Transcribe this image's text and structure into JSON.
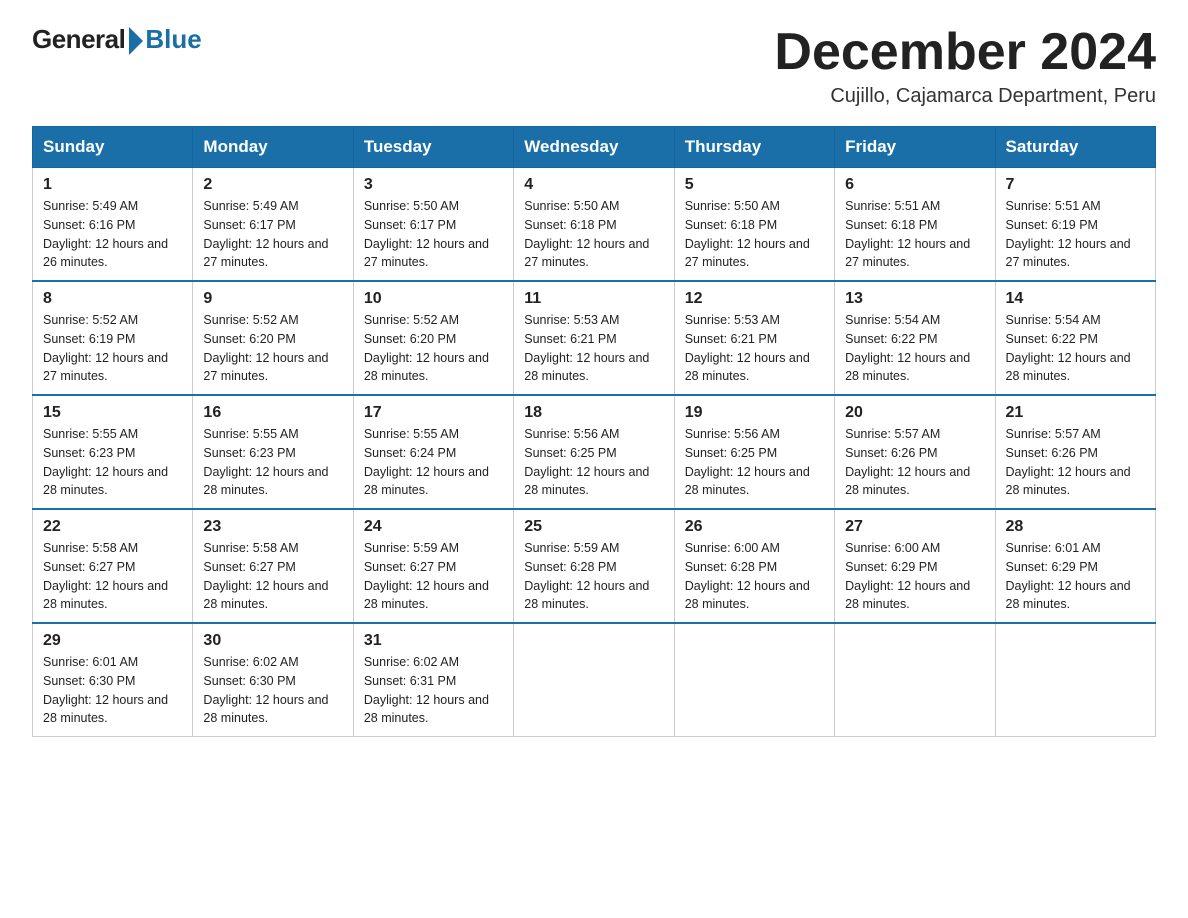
{
  "header": {
    "logo_general": "General",
    "logo_blue": "Blue",
    "month_title": "December 2024",
    "location": "Cujillo, Cajamarca Department, Peru"
  },
  "days_of_week": [
    "Sunday",
    "Monday",
    "Tuesday",
    "Wednesday",
    "Thursday",
    "Friday",
    "Saturday"
  ],
  "weeks": [
    [
      {
        "num": "1",
        "sunrise": "5:49 AM",
        "sunset": "6:16 PM",
        "daylight": "12 hours and 26 minutes."
      },
      {
        "num": "2",
        "sunrise": "5:49 AM",
        "sunset": "6:17 PM",
        "daylight": "12 hours and 27 minutes."
      },
      {
        "num": "3",
        "sunrise": "5:50 AM",
        "sunset": "6:17 PM",
        "daylight": "12 hours and 27 minutes."
      },
      {
        "num": "4",
        "sunrise": "5:50 AM",
        "sunset": "6:18 PM",
        "daylight": "12 hours and 27 minutes."
      },
      {
        "num": "5",
        "sunrise": "5:50 AM",
        "sunset": "6:18 PM",
        "daylight": "12 hours and 27 minutes."
      },
      {
        "num": "6",
        "sunrise": "5:51 AM",
        "sunset": "6:18 PM",
        "daylight": "12 hours and 27 minutes."
      },
      {
        "num": "7",
        "sunrise": "5:51 AM",
        "sunset": "6:19 PM",
        "daylight": "12 hours and 27 minutes."
      }
    ],
    [
      {
        "num": "8",
        "sunrise": "5:52 AM",
        "sunset": "6:19 PM",
        "daylight": "12 hours and 27 minutes."
      },
      {
        "num": "9",
        "sunrise": "5:52 AM",
        "sunset": "6:20 PM",
        "daylight": "12 hours and 27 minutes."
      },
      {
        "num": "10",
        "sunrise": "5:52 AM",
        "sunset": "6:20 PM",
        "daylight": "12 hours and 28 minutes."
      },
      {
        "num": "11",
        "sunrise": "5:53 AM",
        "sunset": "6:21 PM",
        "daylight": "12 hours and 28 minutes."
      },
      {
        "num": "12",
        "sunrise": "5:53 AM",
        "sunset": "6:21 PM",
        "daylight": "12 hours and 28 minutes."
      },
      {
        "num": "13",
        "sunrise": "5:54 AM",
        "sunset": "6:22 PM",
        "daylight": "12 hours and 28 minutes."
      },
      {
        "num": "14",
        "sunrise": "5:54 AM",
        "sunset": "6:22 PM",
        "daylight": "12 hours and 28 minutes."
      }
    ],
    [
      {
        "num": "15",
        "sunrise": "5:55 AM",
        "sunset": "6:23 PM",
        "daylight": "12 hours and 28 minutes."
      },
      {
        "num": "16",
        "sunrise": "5:55 AM",
        "sunset": "6:23 PM",
        "daylight": "12 hours and 28 minutes."
      },
      {
        "num": "17",
        "sunrise": "5:55 AM",
        "sunset": "6:24 PM",
        "daylight": "12 hours and 28 minutes."
      },
      {
        "num": "18",
        "sunrise": "5:56 AM",
        "sunset": "6:25 PM",
        "daylight": "12 hours and 28 minutes."
      },
      {
        "num": "19",
        "sunrise": "5:56 AM",
        "sunset": "6:25 PM",
        "daylight": "12 hours and 28 minutes."
      },
      {
        "num": "20",
        "sunrise": "5:57 AM",
        "sunset": "6:26 PM",
        "daylight": "12 hours and 28 minutes."
      },
      {
        "num": "21",
        "sunrise": "5:57 AM",
        "sunset": "6:26 PM",
        "daylight": "12 hours and 28 minutes."
      }
    ],
    [
      {
        "num": "22",
        "sunrise": "5:58 AM",
        "sunset": "6:27 PM",
        "daylight": "12 hours and 28 minutes."
      },
      {
        "num": "23",
        "sunrise": "5:58 AM",
        "sunset": "6:27 PM",
        "daylight": "12 hours and 28 minutes."
      },
      {
        "num": "24",
        "sunrise": "5:59 AM",
        "sunset": "6:27 PM",
        "daylight": "12 hours and 28 minutes."
      },
      {
        "num": "25",
        "sunrise": "5:59 AM",
        "sunset": "6:28 PM",
        "daylight": "12 hours and 28 minutes."
      },
      {
        "num": "26",
        "sunrise": "6:00 AM",
        "sunset": "6:28 PM",
        "daylight": "12 hours and 28 minutes."
      },
      {
        "num": "27",
        "sunrise": "6:00 AM",
        "sunset": "6:29 PM",
        "daylight": "12 hours and 28 minutes."
      },
      {
        "num": "28",
        "sunrise": "6:01 AM",
        "sunset": "6:29 PM",
        "daylight": "12 hours and 28 minutes."
      }
    ],
    [
      {
        "num": "29",
        "sunrise": "6:01 AM",
        "sunset": "6:30 PM",
        "daylight": "12 hours and 28 minutes."
      },
      {
        "num": "30",
        "sunrise": "6:02 AM",
        "sunset": "6:30 PM",
        "daylight": "12 hours and 28 minutes."
      },
      {
        "num": "31",
        "sunrise": "6:02 AM",
        "sunset": "6:31 PM",
        "daylight": "12 hours and 28 minutes."
      },
      null,
      null,
      null,
      null
    ]
  ],
  "labels": {
    "sunrise": "Sunrise:",
    "sunset": "Sunset:",
    "daylight": "Daylight:"
  }
}
